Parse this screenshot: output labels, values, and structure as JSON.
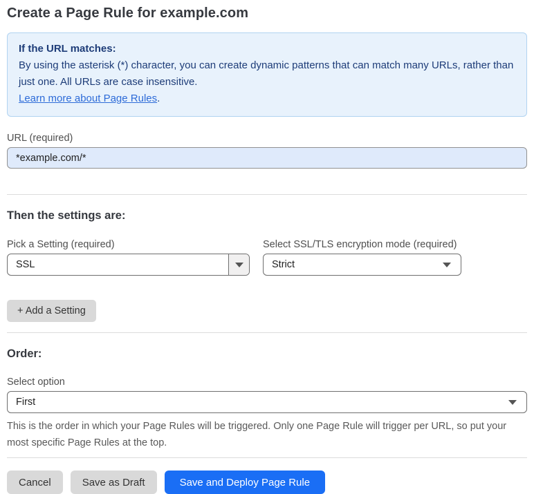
{
  "page": {
    "title": "Create a Page Rule for example.com"
  },
  "info_box": {
    "heading": "If the URL matches:",
    "body": "By using the asterisk (*) character, you can create dynamic patterns that can match many URLs, rather than just one. All URLs are case insensitive.",
    "link_label": "Learn more about Page Rules",
    "link_suffix": "."
  },
  "url_field": {
    "label": "URL (required)",
    "value": "*example.com/*"
  },
  "settings_section": {
    "heading": "Then the settings are:",
    "setting_picker": {
      "label": "Pick a Setting (required)",
      "value": "SSL"
    },
    "mode_picker": {
      "label": "Select SSL/TLS encryption mode (required)",
      "value": "Strict"
    },
    "add_setting_label": "+ Add a Setting"
  },
  "order_section": {
    "heading": "Order:",
    "select_label": "Select option",
    "value": "First",
    "help_text": "This is the order in which your Page Rules will be triggered. Only one Page Rule will trigger per URL, so put your most specific Page Rules at the top."
  },
  "footer": {
    "cancel_label": "Cancel",
    "save_draft_label": "Save as Draft",
    "save_deploy_label": "Save and Deploy Page Rule"
  },
  "colors": {
    "info_background": "#e8f2fc",
    "info_border": "#b0d3f1",
    "info_text": "#1d3c78",
    "link": "#2d6bd8",
    "input_background": "#dfeafb",
    "primary_button": "#1a6ef5",
    "gray_button": "#d9d9d9",
    "divider": "#dcdcdc"
  },
  "icons": {
    "dropdown_arrow": "chevron-down-icon"
  }
}
